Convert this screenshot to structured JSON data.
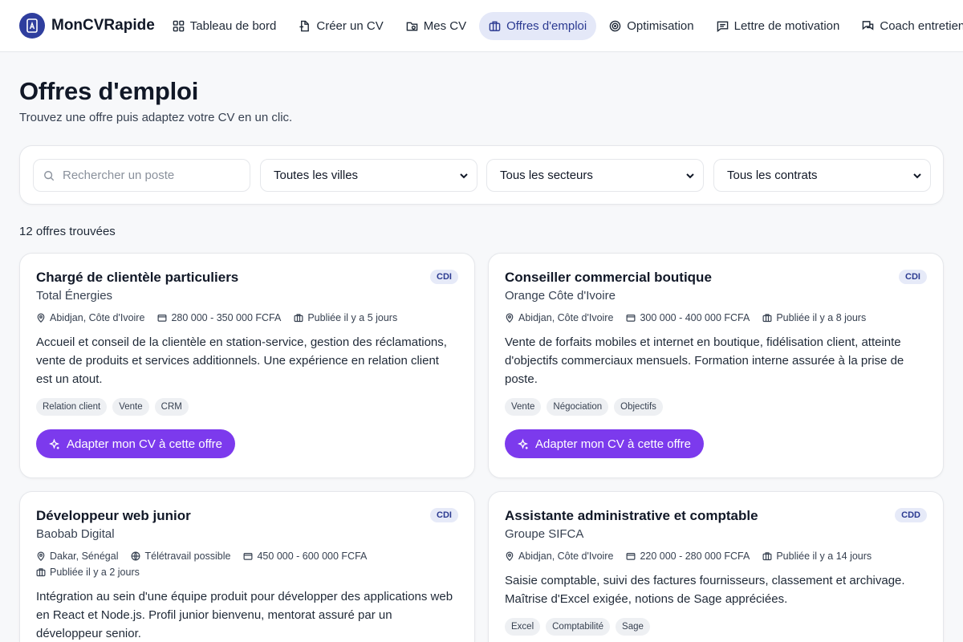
{
  "app": {
    "brand": "MonCVRapide",
    "nav": [
      {
        "label": "Tableau de bord",
        "icon": "dashboard-icon"
      },
      {
        "label": "Créer un CV",
        "icon": "file-plus-icon"
      },
      {
        "label": "Mes CV",
        "icon": "folder-icon"
      },
      {
        "label": "Offres d'emploi",
        "icon": "briefcase-icon",
        "active": true
      },
      {
        "label": "Optimisation",
        "icon": "target-icon"
      },
      {
        "label": "Lettre de motivation",
        "icon": "message-icon"
      },
      {
        "label": "Coach entretien",
        "icon": "chat-icon"
      }
    ]
  },
  "header": {
    "title": "Offres d'emploi",
    "subtitle": "Trouvez une offre puis adaptez votre CV en un clic."
  },
  "filters": {
    "search_placeholder": "Rechercher un poste",
    "city": "Toutes les villes",
    "sector": "Tous les secteurs",
    "contract": "Tous les contrats"
  },
  "results": {
    "count_text": "12 offres trouvées"
  },
  "cta_label": "Adapter mon CV à cette offre",
  "jobs": [
    {
      "title": "Chargé de clientèle particuliers",
      "company": "Total Énergies",
      "contract": "CDI",
      "location": "Abidjan, Côte d'Ivoire",
      "salary": "280 000 - 350 000 FCFA",
      "published": "Publiée il y a 5 jours",
      "description": "Accueil et conseil de la clientèle en station-service, gestion des réclamations, vente de produits et services additionnels. Une expérience en relation client est un atout.",
      "tags": [
        "Relation client",
        "Vente",
        "CRM"
      ]
    },
    {
      "title": "Conseiller commercial boutique",
      "company": "Orange Côte d'Ivoire",
      "contract": "CDI",
      "location": "Abidjan, Côte d'Ivoire",
      "salary": "300 000 - 400 000 FCFA",
      "published": "Publiée il y a 8 jours",
      "description": "Vente de forfaits mobiles et internet en boutique, fidélisation client, atteinte d'objectifs commerciaux mensuels. Formation interne assurée à la prise de poste.",
      "tags": [
        "Vente",
        "Négociation",
        "Objectifs"
      ]
    },
    {
      "title": "Développeur web junior",
      "company": "Baobab Digital",
      "contract": "CDI",
      "location": "Dakar, Sénégal",
      "remote": "Télétravail possible",
      "salary": "450 000 - 600 000 FCFA",
      "published": "Publiée il y a 2 jours",
      "description": "Intégration au sein d'une équipe produit pour développer des applications web en React et Node.js. Profil junior bienvenu, mentorat assuré par un développeur senior.",
      "tags": []
    },
    {
      "title": "Assistante administrative et comptable",
      "company": "Groupe SIFCA",
      "contract": "CDD",
      "location": "Abidjan, Côte d'Ivoire",
      "salary": "220 000 - 280 000 FCFA",
      "published": "Publiée il y a 14 jours",
      "description": "Saisie comptable, suivi des factures fournisseurs, classement et archivage. Maîtrise d'Excel exigée, notions de Sage appréciées.",
      "tags": [
        "Excel",
        "Comptabilité",
        "Sage"
      ]
    }
  ]
}
